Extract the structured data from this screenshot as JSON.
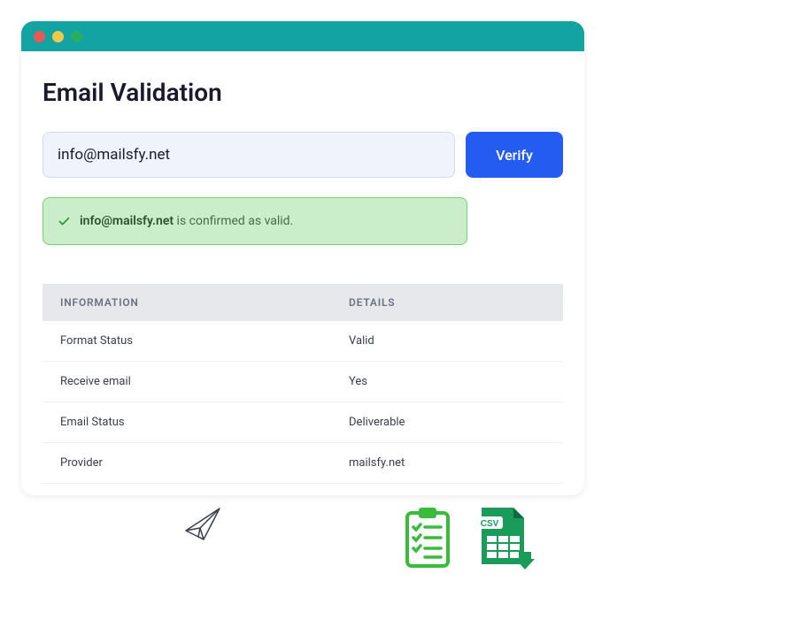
{
  "page": {
    "title": "Email Validation"
  },
  "form": {
    "email_value": "info@mailsfy.net",
    "verify_label": "Verify"
  },
  "banner": {
    "email": "info@mailsfy.net",
    "suffix": " is confirmed as valid."
  },
  "table": {
    "header_info": "INFORMATION",
    "header_details": "DETAILS",
    "rows": [
      {
        "label": "Format Status",
        "value": "Valid",
        "cls": "val-green"
      },
      {
        "label": "Receive email",
        "value": "Yes",
        "cls": "val-green"
      },
      {
        "label": "Email Status",
        "value": "Deliverable",
        "cls": "val-green"
      },
      {
        "label": "Provider",
        "value": "mailsfy.net",
        "cls": "val-red"
      }
    ]
  }
}
